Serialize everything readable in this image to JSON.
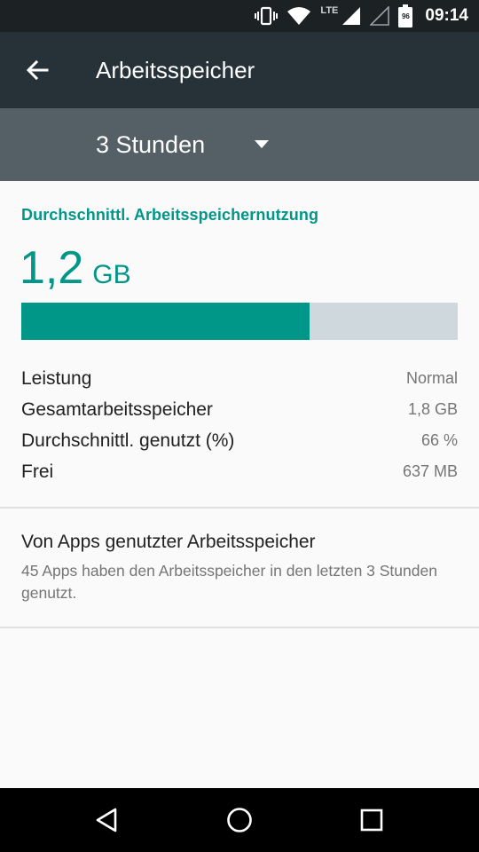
{
  "statusbar": {
    "network_label": "LTE",
    "battery_level": "96",
    "time": "09:14"
  },
  "toolbar": {
    "title": "Arbeitsspeicher",
    "back_icon": "arrow-back-icon"
  },
  "subbar": {
    "spinner_value": "3 Stunden",
    "caret_icon": "triangle-down-icon"
  },
  "summary": {
    "label": "Durchschnittl. Arbeitsspeichernutzung",
    "value": "1,2",
    "unit": "GB",
    "usage_fraction": 0.66
  },
  "stats": [
    {
      "key": "Leistung",
      "value": "Normal"
    },
    {
      "key": "Gesamtarbeitsspeicher",
      "value": "1,8 GB"
    },
    {
      "key": "Durchschnittl. genutzt (%)",
      "value": "66 %"
    },
    {
      "key": "Frei",
      "value": "637 MB"
    }
  ],
  "apps_item": {
    "title": "Von Apps genutzter Arbeitsspeicher",
    "subtitle": "45 Apps haben den Arbeitsspeicher in den letzten 3 Stunden genutzt."
  },
  "colors": {
    "accent": "#009688",
    "toolbar": "#263238",
    "subbar": "#546066",
    "bar_track": "#cfd8dc"
  }
}
